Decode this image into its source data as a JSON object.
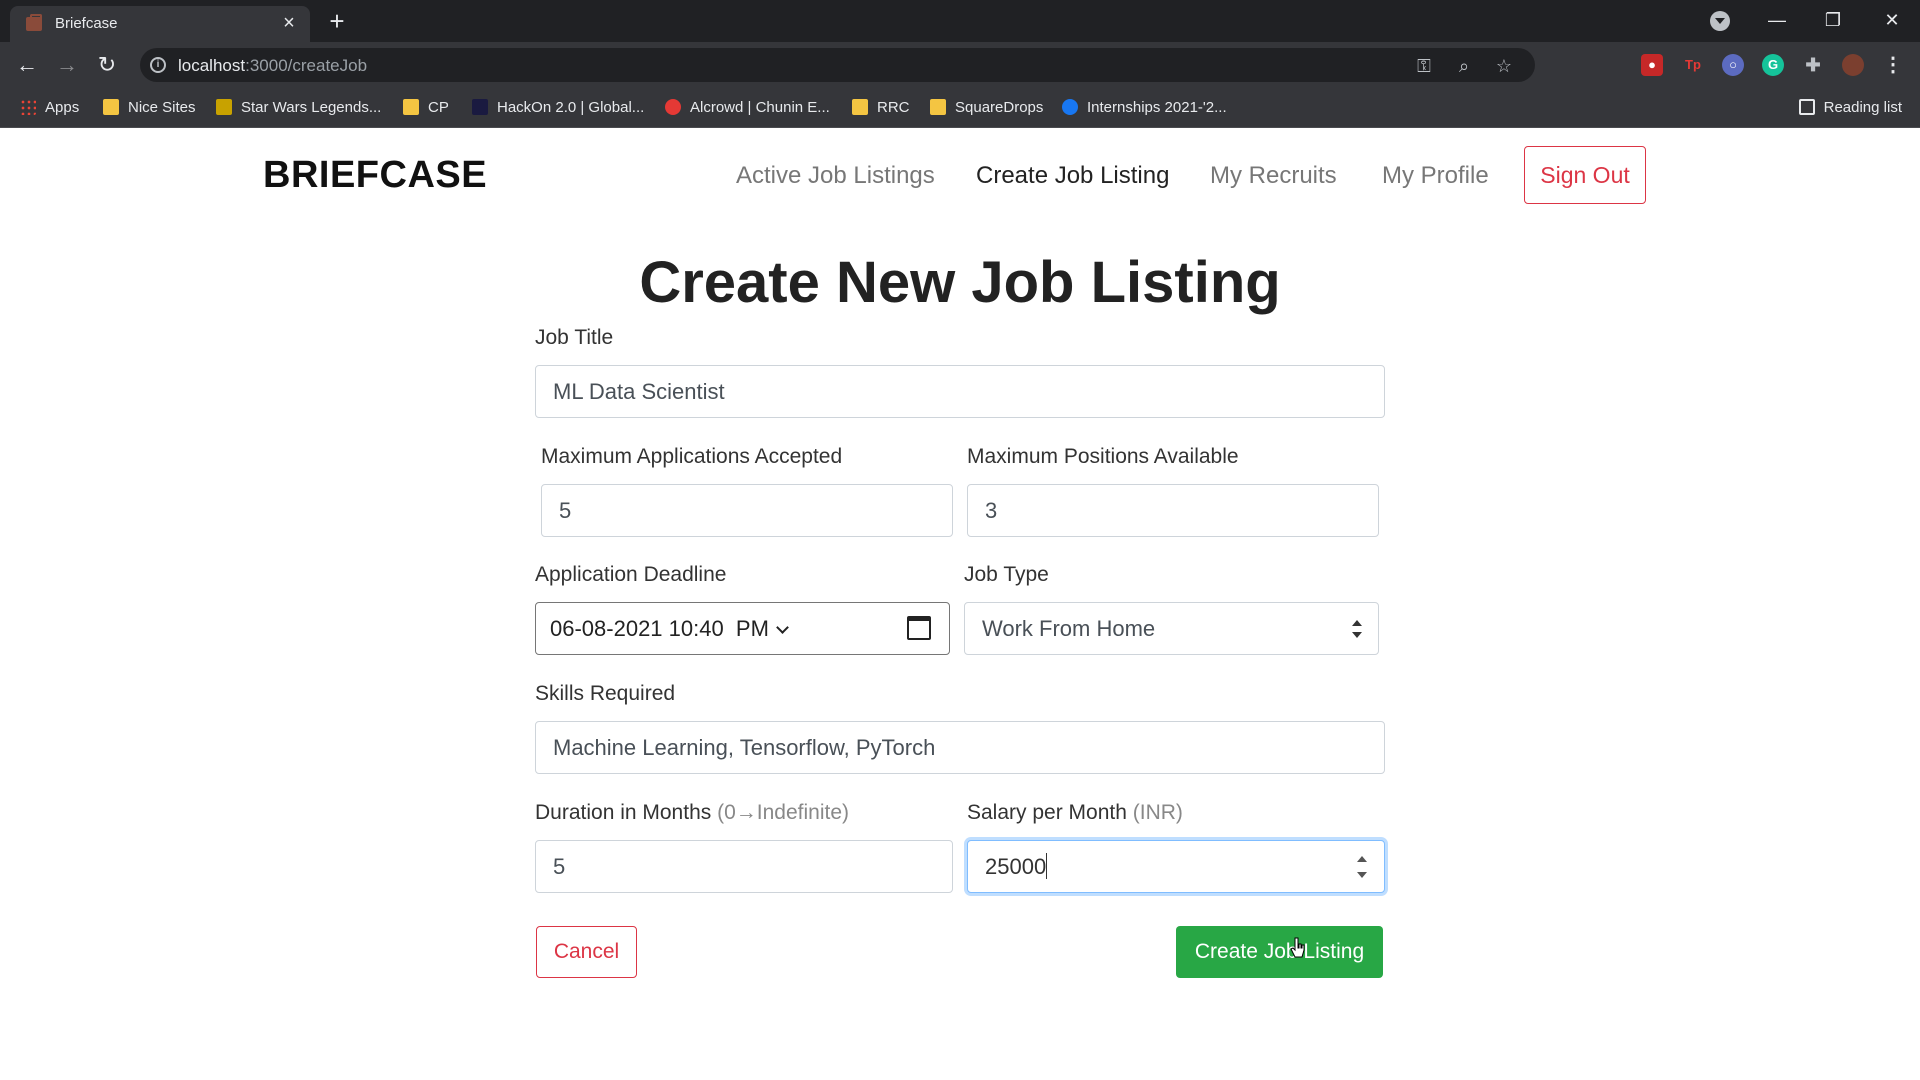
{
  "browser": {
    "tab_title": "Briefcase",
    "url_host": "localhost",
    "url_path": ":3000/createJob",
    "bookmarks": [
      "Apps",
      "Nice Sites",
      "Star Wars Legends...",
      "CP",
      "HackOn 2.0 | Global...",
      "Alcrowd | Chunin E...",
      "RRC",
      "SquareDrops",
      "Internships 2021-'2..."
    ],
    "reading_list": "Reading list"
  },
  "nav": {
    "brand": "BRIEFCASE",
    "links": [
      "Active Job Listings",
      "Create Job Listing",
      "My Recruits",
      "My Profile"
    ],
    "active": "Create Job Listing",
    "sign_out": "Sign Out"
  },
  "form": {
    "heading": "Create New Job Listing",
    "job_title_label": "Job Title",
    "job_title_value": "ML Data Scientist",
    "max_apps_label": "Maximum Applications Accepted",
    "max_apps_value": "5",
    "max_positions_label": "Maximum Positions Available",
    "max_positions_value": "3",
    "deadline_label": "Application Deadline",
    "deadline_value": "06-08-2021 10:40  PM",
    "job_type_label": "Job Type",
    "job_type_value": "Work From Home",
    "skills_label": "Skills Required",
    "skills_value": "Machine Learning, Tensorflow, PyTorch",
    "duration_label": "Duration in Months",
    "duration_hint": "(0→Indefinite)",
    "duration_value": "5",
    "salary_label": "Salary per Month",
    "salary_hint": "(INR)",
    "salary_value": "25000",
    "cancel_label": "Cancel",
    "create_label": "Create Job Listing"
  },
  "colors": {
    "danger": "#dc3545",
    "success": "#28a745",
    "focus": "#80bdff"
  }
}
